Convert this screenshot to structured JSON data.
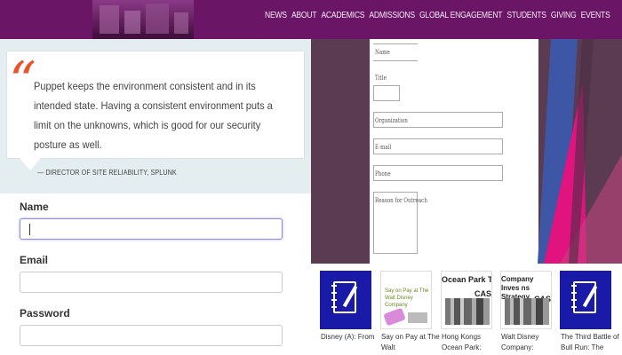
{
  "nav": {
    "items": [
      "NEWS",
      "ABOUT",
      "ACADEMICS",
      "ADMISSIONS",
      "GLOBAL ENGAGEMENT",
      "STUDENTS",
      "GIVING",
      "EVENTS"
    ]
  },
  "testimonial": {
    "quote": "Puppet keeps the environment consistent and in its intended state. Having a consistent environment puts a limit on the unknowns, which is good for our security posture as well.",
    "attribution": "— DIRECTOR OF SITE RELIABILITY, SPLUNK"
  },
  "signup_form": {
    "name_label": "Name",
    "name_value": "",
    "email_label": "Email",
    "email_value": "",
    "password_label": "Password",
    "password_value": ""
  },
  "request_form": {
    "name_placeholder": "Name",
    "title_label": "Title",
    "organization_placeholder": "Organization",
    "email_placeholder": "E-mail",
    "phone_placeholder": "Phone",
    "reason_placeholder": "Reason for Outreach"
  },
  "books": [
    {
      "cover": "notebook-icon",
      "title": "Disney (A): From"
    },
    {
      "cover": "case",
      "cover_text": "Say on Pay at The Walt Disney Company",
      "title": "Say on Pay at The Walt"
    },
    {
      "cover": "case",
      "cover_text": "Ocean Park Tal",
      "cover_tag": "CAS",
      "title": "Hong Kongs Ocean Park:"
    },
    {
      "cover": "case",
      "cover_text": "Company Inves ns Strategy",
      "cover_tag": "CAS",
      "title": "Walt Disney Company:"
    },
    {
      "cover": "notebook-icon",
      "title": "The Third Battle of Bull Run: The"
    }
  ],
  "colors": {
    "nav_bg": "#6b1566",
    "quote_accent": "#e8552b",
    "right_panel_bg": "#5b3b52",
    "stripe_blue": "#3e56a6",
    "stripe_pink": "#e0137f",
    "notebook_blue": "#1a1aa8"
  }
}
